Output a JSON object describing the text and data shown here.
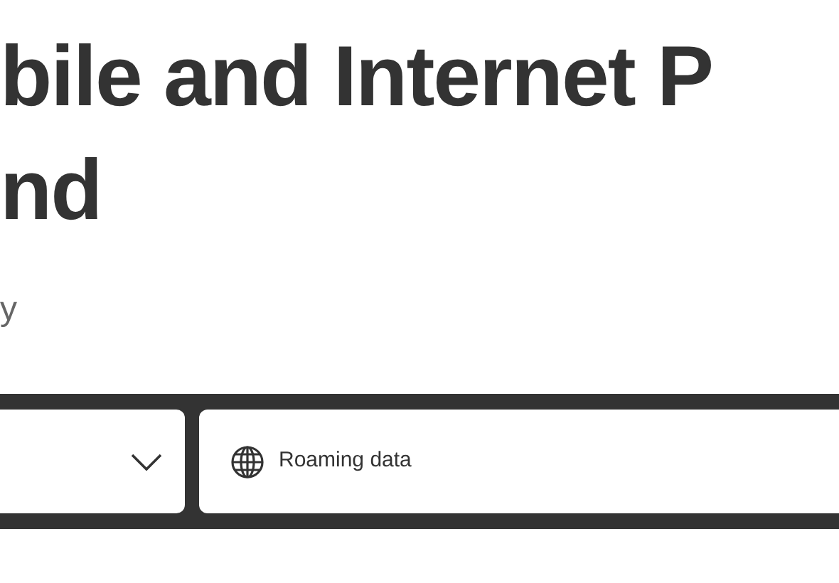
{
  "heading": {
    "lines": [
      "bile and Internet P",
      "nd"
    ]
  },
  "subtitle": "y",
  "filters": [
    {
      "kind": "dropdown"
    },
    {
      "kind": "field",
      "label": "Roaming data"
    }
  ]
}
